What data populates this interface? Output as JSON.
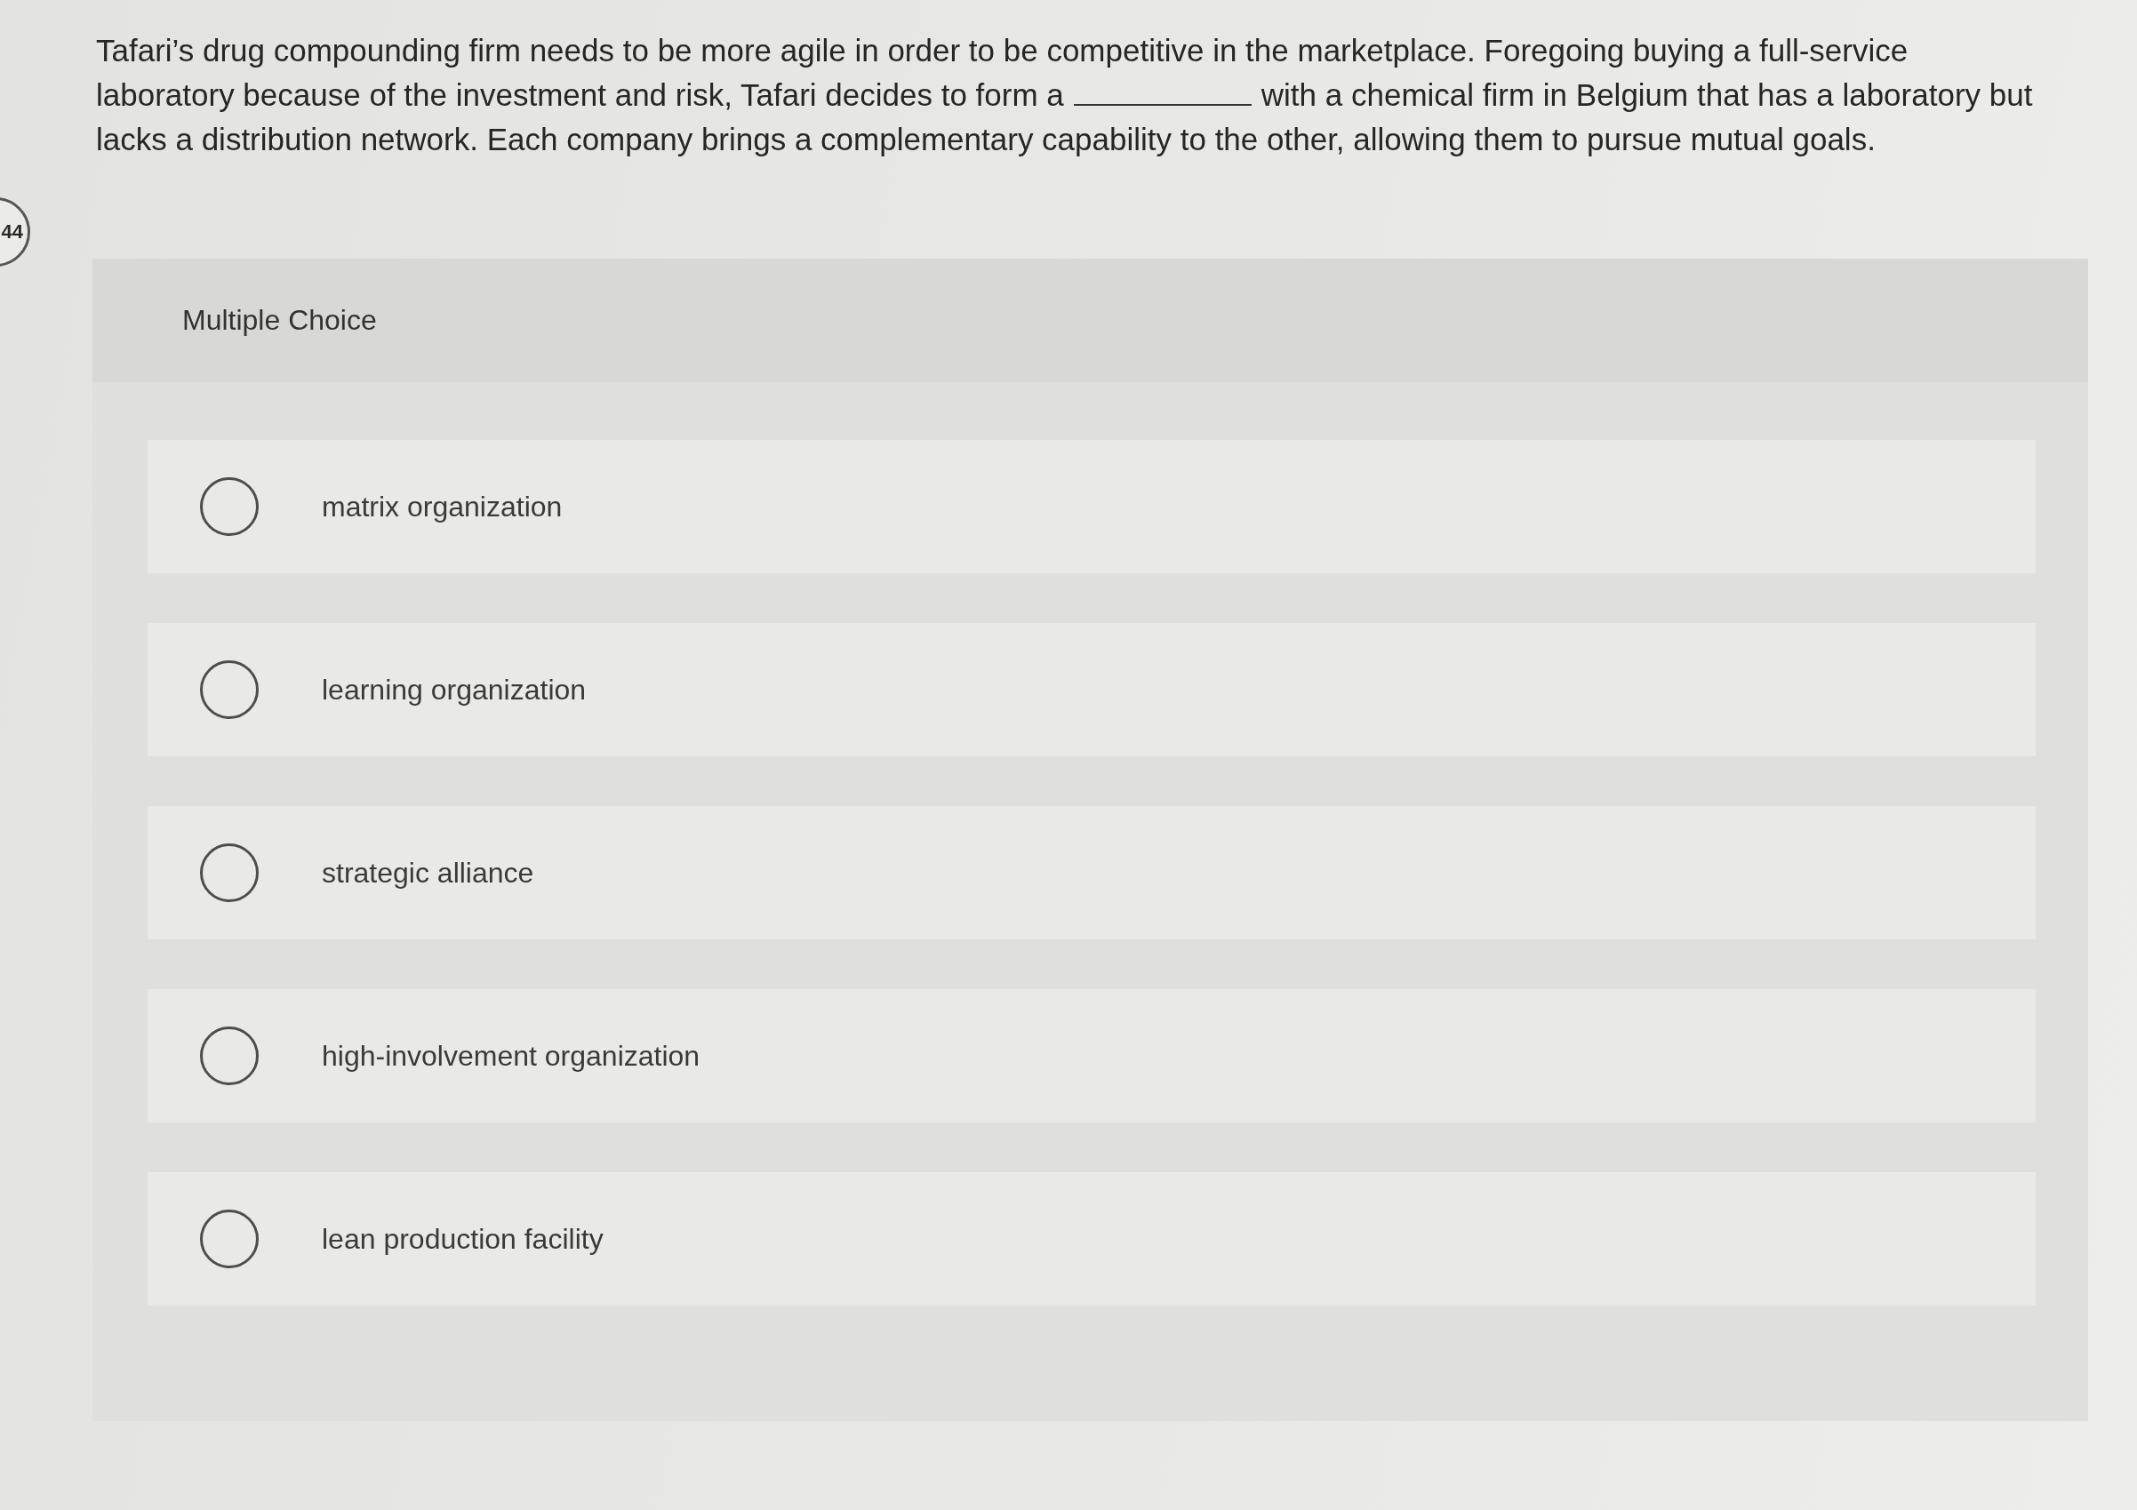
{
  "question_number": "44",
  "question": {
    "lines": [
      {
        "parts": [
          {
            "kind": "text",
            "text": "Tafari’s drug compounding firm needs to be more agile in order to be competitive in the marketplace. Foregoing buying a full-service"
          }
        ]
      },
      {
        "parts": [
          {
            "kind": "text",
            "text": "laboratory because of the investment and risk, Tafari decides to form a"
          },
          {
            "kind": "blank"
          },
          {
            "kind": "text",
            "text": "with a chemical firm in Belgium that has a laboratory but"
          }
        ]
      },
      {
        "parts": [
          {
            "kind": "text",
            "text": "lacks a distribution network. Each company brings a complementary capability to the other, allowing them to pursue mutual goals."
          }
        ]
      }
    ]
  },
  "section_title": "Multiple Choice",
  "options": [
    {
      "label": "matrix organization",
      "selected": false
    },
    {
      "label": "learning organization",
      "selected": false
    },
    {
      "label": "strategic alliance",
      "selected": false
    },
    {
      "label": "high-involvement organization",
      "selected": false
    },
    {
      "label": "lean production facility",
      "selected": false
    }
  ]
}
